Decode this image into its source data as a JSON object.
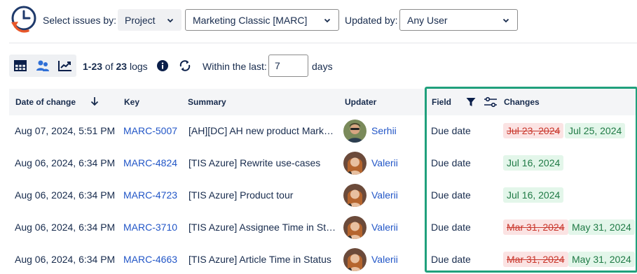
{
  "filters": {
    "select_by_label": "Select issues by:",
    "select_by_value": "Project",
    "project_value": "Marketing Classic [MARC]",
    "updated_by_label": "Updated by:",
    "updated_by_value": "Any User"
  },
  "toolbar": {
    "range": "1-23",
    "of": "of",
    "total": "23",
    "logs": "logs",
    "within_label": "Within the last:",
    "days_value": "7",
    "days_label": "days"
  },
  "table": {
    "headers": {
      "date": "Date of change",
      "key": "Key",
      "summary": "Summary",
      "updater": "Updater",
      "field": "Field",
      "changes": "Changes"
    },
    "rows": [
      {
        "date": "Aug 07, 2024, 5:51 PM",
        "key": "MARC-5007",
        "summary": "[AH][DC] AH new product Mark…",
        "updater": "Serhii",
        "field": "Due date",
        "old": "Jul 23, 2024",
        "new": "Jul 25, 2024"
      },
      {
        "date": "Aug 06, 2024, 6:34 PM",
        "key": "MARC-4824",
        "summary": "[TIS Azure] Rewrite use-cases",
        "updater": "Valerii",
        "field": "Due date",
        "old": "",
        "new": "Jul 16, 2024"
      },
      {
        "date": "Aug 06, 2024, 6:34 PM",
        "key": "MARC-4723",
        "summary": "[TIS Azure] Product tour",
        "updater": "Valerii",
        "field": "Due date",
        "old": "",
        "new": "Jul 16, 2024"
      },
      {
        "date": "Aug 06, 2024, 6:34 PM",
        "key": "MARC-3710",
        "summary": "[TIS Azure] Assignee Time in St…",
        "updater": "Valerii",
        "field": "Due date",
        "old": "Mar 31, 2024",
        "new": "May 31, 2024"
      },
      {
        "date": "Aug 06, 2024, 6:34 PM",
        "key": "MARC-4663",
        "summary": "[TIS Azure] Article Time in Status",
        "updater": "Valerii",
        "field": "Due date",
        "old": "Mar 31, 2024",
        "new": "May 31, 2024"
      }
    ]
  },
  "colors": {
    "accent": "#2256c7",
    "highlight_border": "#20a07c",
    "removed_bg": "#fbe3e3",
    "added_bg": "#e3f6ea",
    "logo_orange": "#e8572a",
    "logo_blue": "#1f3a6b"
  },
  "icons": [
    "app-logo-icon",
    "chevron-down-icon",
    "table-view-icon",
    "users-view-icon",
    "chart-view-icon",
    "info-icon",
    "refresh-icon",
    "sort-down-icon",
    "filter-icon",
    "settings-sliders-icon"
  ]
}
